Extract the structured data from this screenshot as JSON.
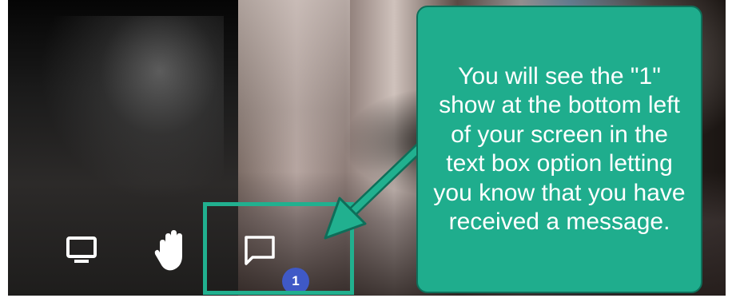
{
  "video": {
    "chat_unread_count": "1"
  },
  "controls": {
    "share_screen_icon": "monitor-icon",
    "raise_hand_icon": "hand-icon",
    "chat_icon": "chat-bubble-icon"
  },
  "annotation": {
    "callout_text": "You will see the \"1\" show at the bottom left of your screen in the text box option letting you know that you have received a message.",
    "highlight_color": "#21b08f",
    "callout_color": "#1fad8d",
    "badge_color": "#3f59c6"
  }
}
